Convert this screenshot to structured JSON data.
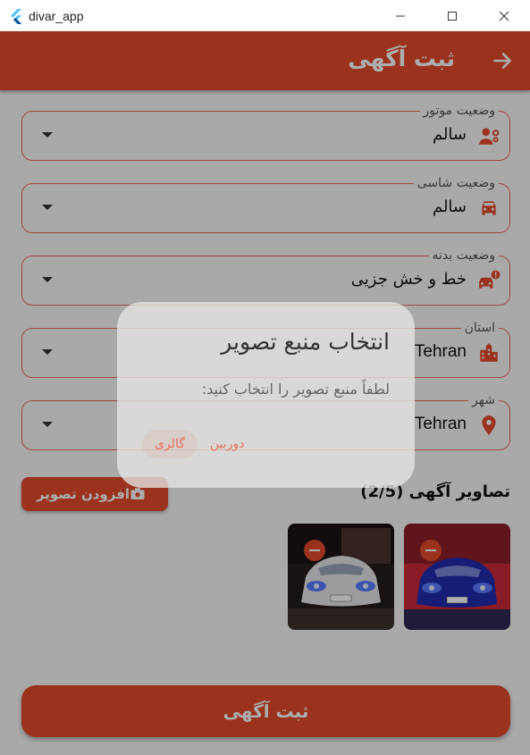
{
  "window": {
    "title": "divar_app"
  },
  "appbar": {
    "title": "ثبت آگهی"
  },
  "form": {
    "fields": [
      {
        "label": "وضعیت موتور",
        "value": "سالم",
        "icon": "engine-repair-icon"
      },
      {
        "label": "وضعیت شاسی",
        "value": "سالم",
        "icon": "car-front-icon"
      },
      {
        "label": "وضعیت بدنه",
        "value": "خط و خش جزیی",
        "icon": "car-crash-icon"
      },
      {
        "label": "استان",
        "value": "Tehran",
        "icon": "city-icon"
      },
      {
        "label": "شهر",
        "value": "Tehran",
        "icon": "location-pin-icon"
      }
    ]
  },
  "images": {
    "title": "تصاویر آگهی (2/5)",
    "add_button": "افزودن تصویر"
  },
  "submit": {
    "label": "ثبت آگهی"
  },
  "dialog": {
    "title": "انتخاب منبع تصویر",
    "message": "لطفاً منبع تصویر را انتخاب کنید:",
    "actions": [
      "دوربین",
      "گالری"
    ]
  },
  "colors": {
    "primary": "#e34a2b",
    "border": "#e8705a"
  }
}
